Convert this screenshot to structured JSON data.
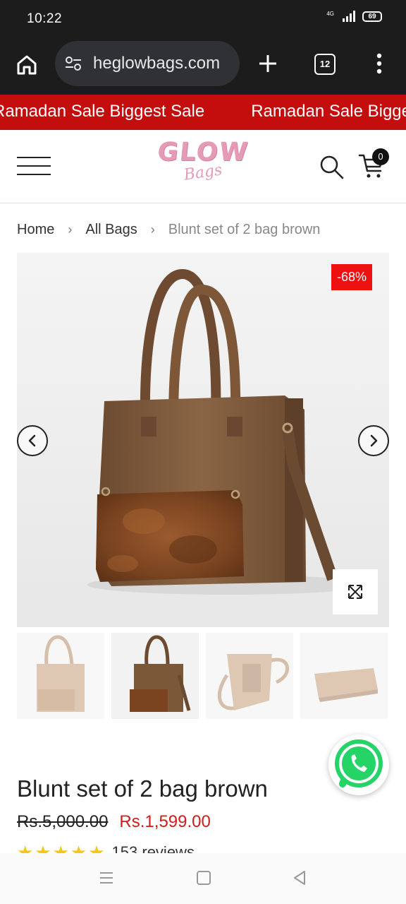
{
  "status_bar": {
    "time": "10:22",
    "network_label": "4G",
    "battery": "69"
  },
  "browser": {
    "url": "heglowbags.com",
    "tab_count": "12"
  },
  "announcement": {
    "items": [
      "Ramadan Sale Biggest Sale",
      "Ramadan Sale Biggest Sale"
    ]
  },
  "header": {
    "logo_main": "GLOW",
    "logo_sub": "Bags",
    "cart_count": "0"
  },
  "breadcrumb": {
    "home": "Home",
    "category": "All Bags",
    "current": "Blunt set of 2 bag brown"
  },
  "gallery": {
    "discount": "-68%",
    "thumbnail_count": 4,
    "active_thumbnail": 2
  },
  "product": {
    "title": "Blunt set of 2 bag brown",
    "price_old": "Rs.5,000.00",
    "price_new": "Rs.1,599.00",
    "rating_stars": 5,
    "stars": "★★★★★",
    "review_count": "153 reviews"
  },
  "colors": {
    "sale_red": "#c40d0d",
    "badge_red": "#ee1111",
    "price_red": "#d11c1c",
    "logo_pink": "#e59ab6",
    "bag_brown": "#7a5233",
    "whatsapp_green": "#25d366"
  }
}
